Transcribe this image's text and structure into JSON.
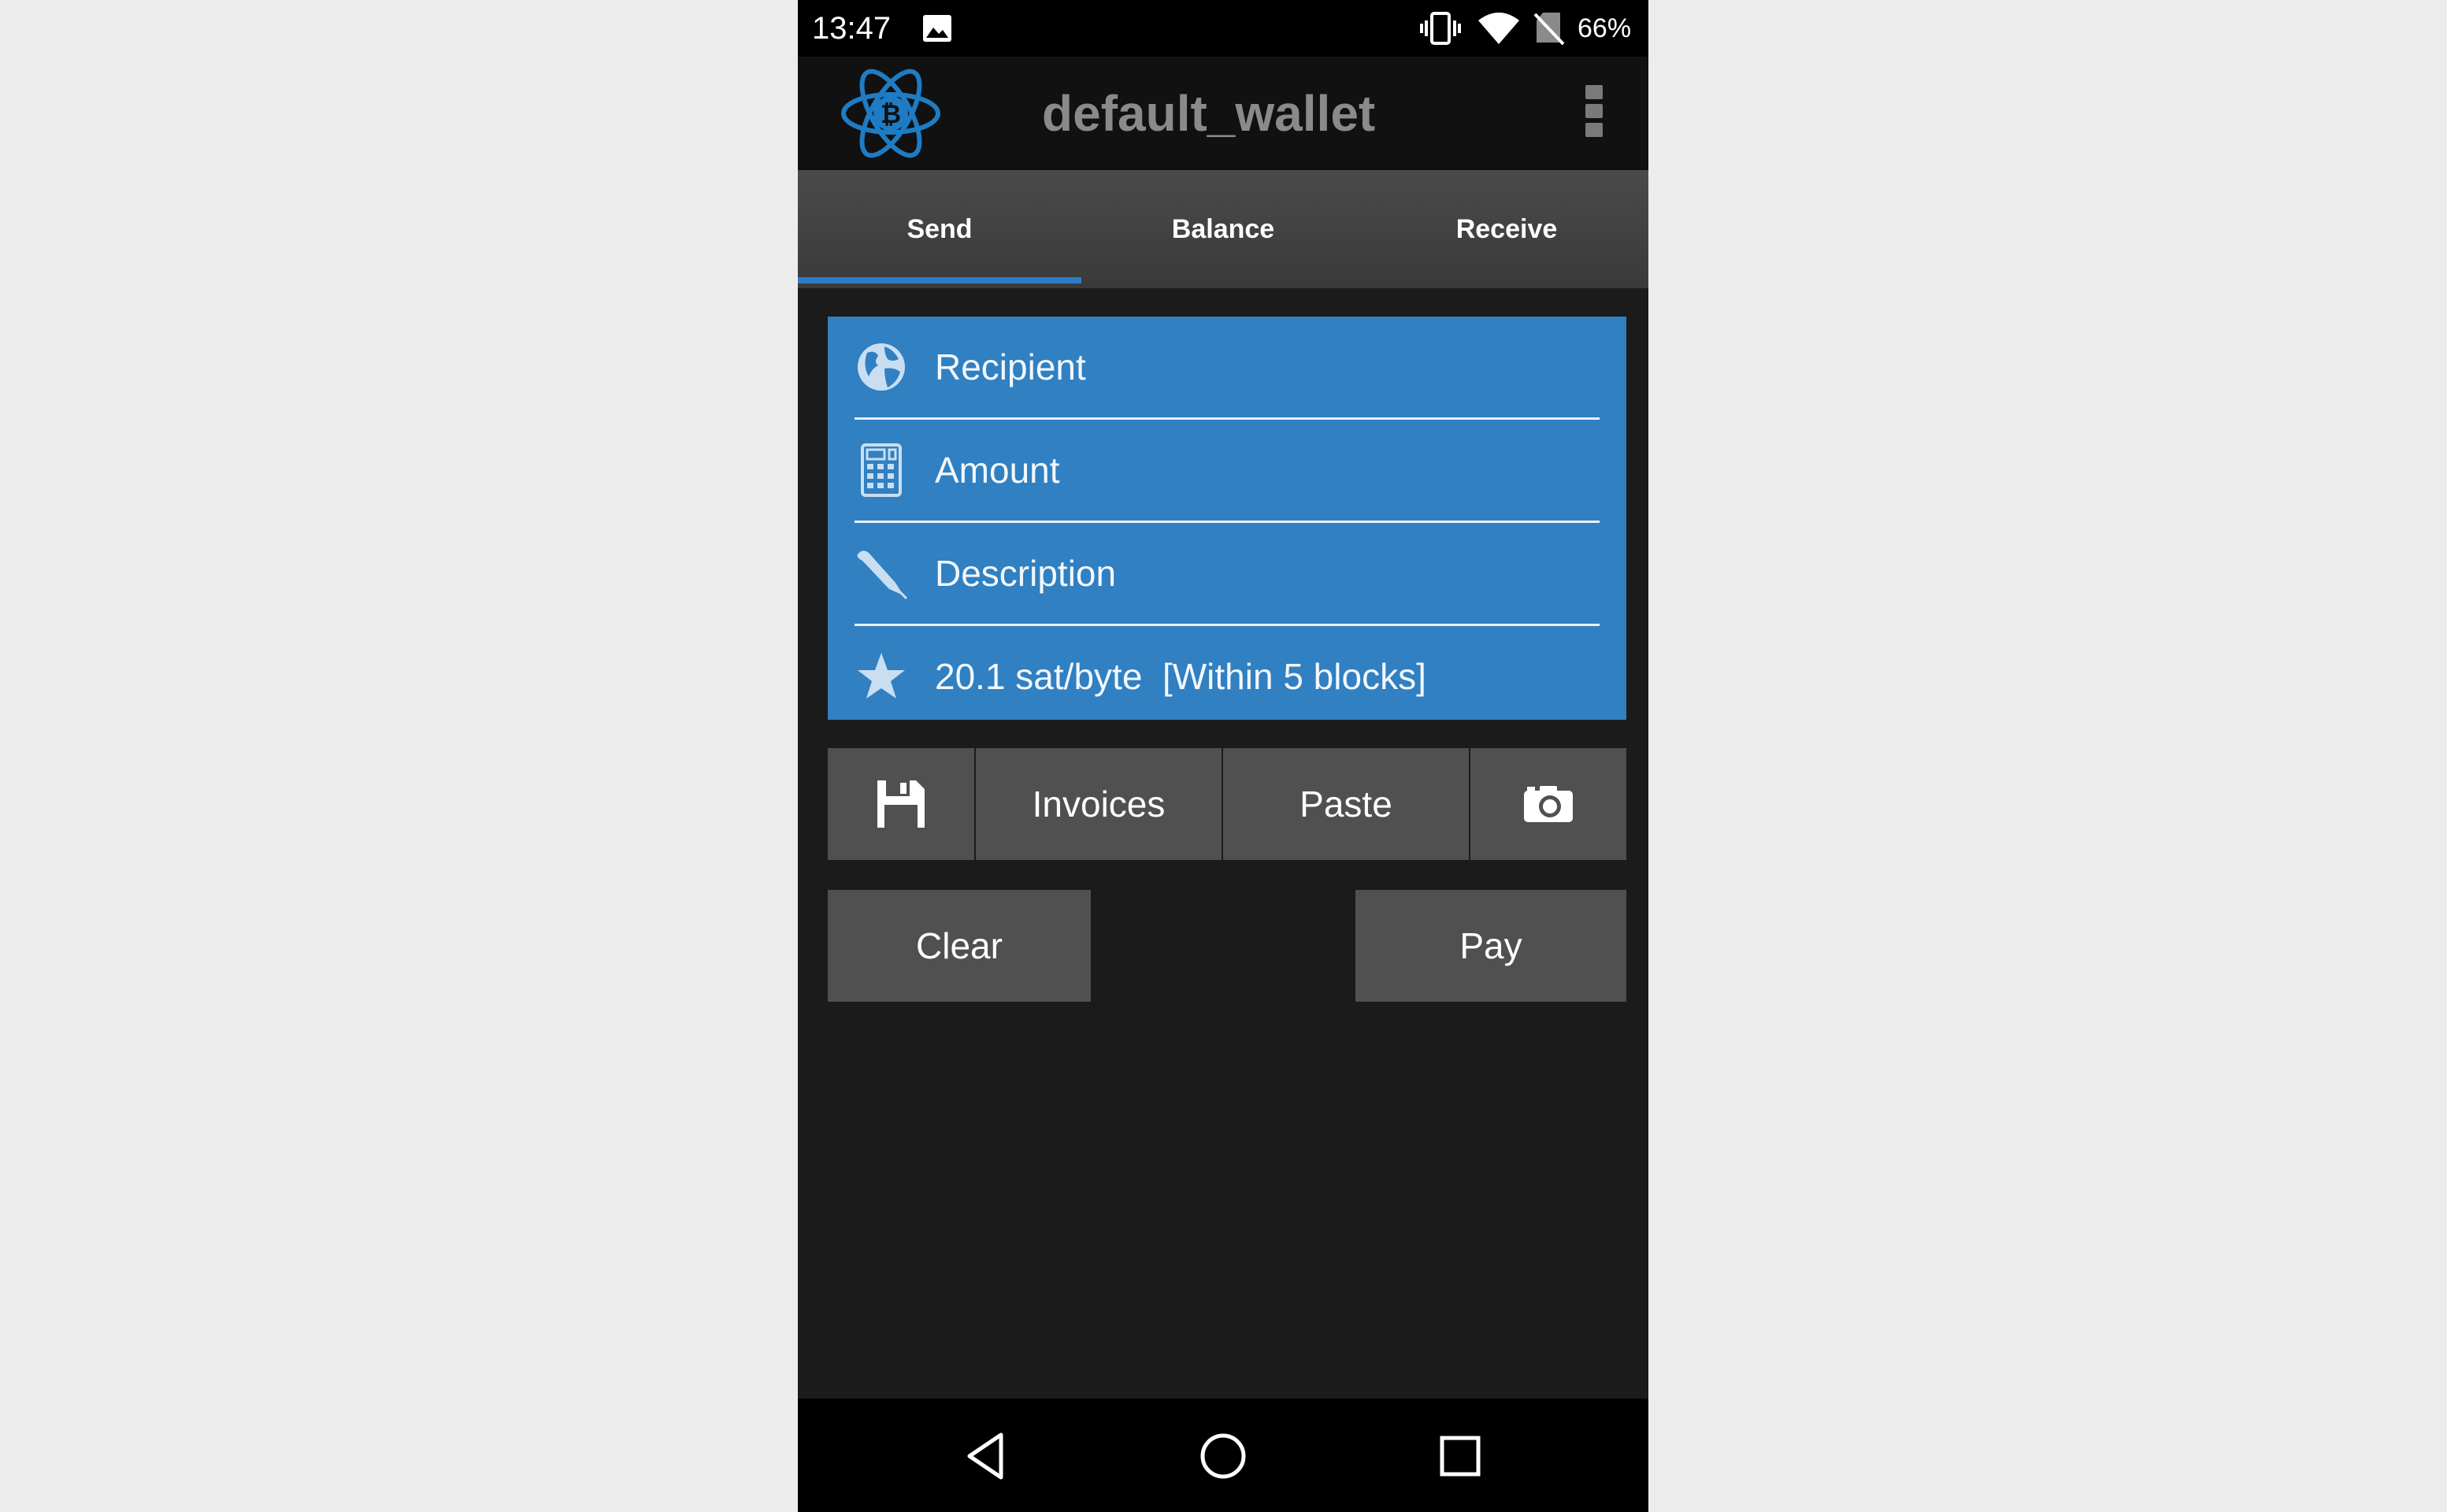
{
  "status_bar": {
    "time": "13:47",
    "battery": "66%",
    "icons": [
      "image-icon",
      "vibrate-icon",
      "wifi-icon",
      "no-sim-icon"
    ]
  },
  "action_bar": {
    "title": "default_wallet",
    "logo_icon": "electrum-bitcoin-logo-icon",
    "menu_icon": "overflow-menu-icon"
  },
  "tabs": [
    {
      "label": "Send",
      "active": true
    },
    {
      "label": "Balance",
      "active": false
    },
    {
      "label": "Receive",
      "active": false
    }
  ],
  "send_form": {
    "recipient": {
      "placeholder": "Recipient",
      "icon": "globe-icon"
    },
    "amount": {
      "placeholder": "Amount",
      "icon": "calculator-icon"
    },
    "description": {
      "placeholder": "Description",
      "icon": "pen-icon"
    },
    "fee": {
      "value": "20.1 sat/byte  [Within 5 blocks]",
      "icon": "star-icon"
    }
  },
  "buttons": {
    "save_icon": "floppy-disk-icon",
    "invoices": "Invoices",
    "paste": "Paste",
    "camera_icon": "camera-icon",
    "clear": "Clear",
    "pay": "Pay"
  },
  "nav_bar": {
    "icons": [
      "back-icon",
      "home-icon",
      "recents-icon"
    ]
  },
  "colors": {
    "accent": "#3080c2",
    "background": "#1b1b1b",
    "button": "#505050",
    "title": "#8a8a8a"
  }
}
